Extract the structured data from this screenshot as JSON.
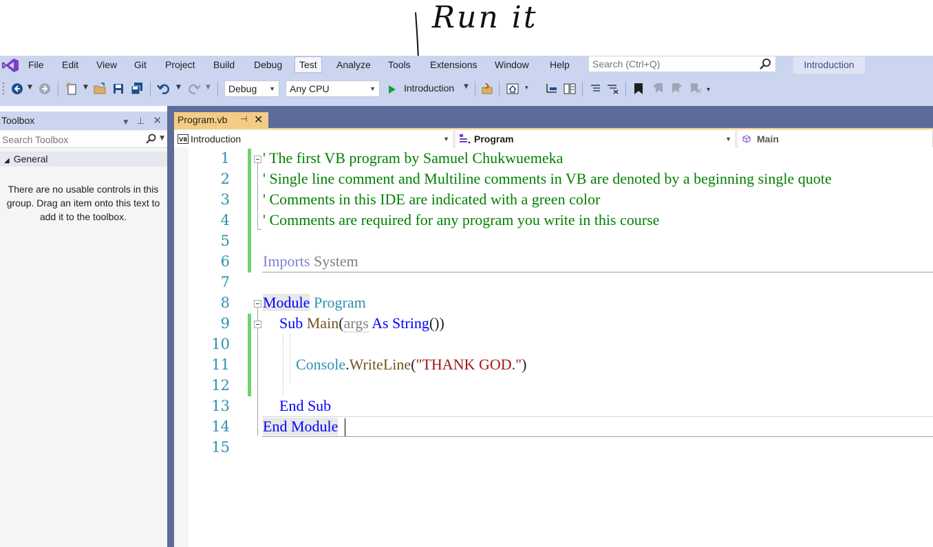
{
  "annotation": {
    "text": "Run it"
  },
  "menu": {
    "items": [
      "File",
      "Edit",
      "View",
      "Git",
      "Project",
      "Build",
      "Debug",
      "Test",
      "Analyze",
      "Tools",
      "Extensions",
      "Window",
      "Help"
    ],
    "active": "Test",
    "search_placeholder": "Search (Ctrl+Q)",
    "solution_name": "Introduction"
  },
  "toolbar": {
    "configuration": "Debug",
    "platform": "Any CPU",
    "run_target": "Introduction"
  },
  "toolbox": {
    "title": "Toolbox",
    "search_placeholder": "Search Toolbox",
    "group": "General",
    "empty_message": "There are no usable controls in this group. Drag an item onto this text to add it to the toolbox."
  },
  "document": {
    "tab_title": "Program.vb",
    "nav_project": "Introduction",
    "nav_type": "Program",
    "nav_member": "Main"
  },
  "code": {
    "line_numbers": [
      "1",
      "2",
      "3",
      "4",
      "5",
      "6",
      "7",
      "8",
      "9",
      "10",
      "11",
      "12",
      "13",
      "14",
      "15"
    ],
    "l1": "' The first VB program by Samuel Chukwuemeka",
    "l2": "' Single line comment and Multiline comments in VB are denoted by a beginning single quote",
    "l3": "' Comments in this IDE are indicated with a green color",
    "l4": "' Comments are required for any program you write in this course",
    "l6_kw": "Imports",
    "l6_ns": " System",
    "l8_kw": "Module",
    "l8_name": " Program",
    "l9_kw": "Sub",
    "l9_name": " Main",
    "l9_open": "(",
    "l9_param": "args",
    "l9_as": " As String",
    "l9_close": "())",
    "l11_obj": "Console",
    "l11_dot": ".",
    "l11_method": "WriteLine",
    "l11_open": "(",
    "l11_str": "\"THANK GOD.\"",
    "l11_close": ")",
    "l13": "End Sub",
    "l14": "End Module"
  }
}
